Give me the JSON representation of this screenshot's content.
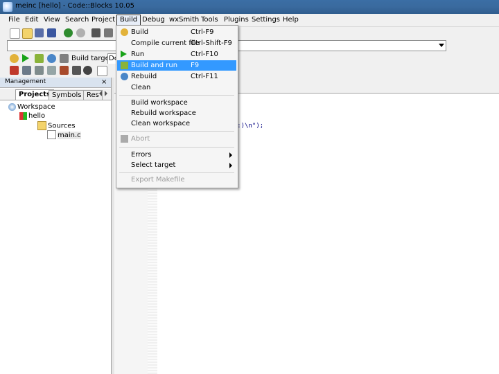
{
  "window": {
    "title": "meinc [hello] - Code::Blocks 10.05"
  },
  "menubar": {
    "items": [
      "File",
      "Edit",
      "View",
      "Search",
      "Project",
      "Build",
      "Debug",
      "wxSmith",
      "Tools",
      "Plugins",
      "Settings",
      "Help"
    ],
    "active": "Build"
  },
  "toolbar": {
    "build_target_label": "Build target:",
    "build_target_value": "De"
  },
  "build_menu": {
    "items": [
      {
        "label": "Build",
        "shortcut": "Ctrl-F9",
        "icon": "build-gear-icon"
      },
      {
        "label": "Compile current file",
        "shortcut": "Ctrl-Shift-F9",
        "icon": ""
      },
      {
        "label": "Run",
        "shortcut": "Ctrl-F10",
        "icon": "run-play-icon"
      },
      {
        "label": "Build and run",
        "shortcut": "F9",
        "icon": "build-and-run-icon",
        "highlighted": true
      },
      {
        "label": "Rebuild",
        "shortcut": "Ctrl-F11",
        "icon": "rebuild-icon"
      },
      {
        "label": "Clean",
        "shortcut": "",
        "icon": ""
      },
      {
        "label": "Build workspace",
        "shortcut": "",
        "icon": ""
      },
      {
        "label": "Rebuild workspace",
        "shortcut": "",
        "icon": ""
      },
      {
        "label": "Clean workspace",
        "shortcut": "",
        "icon": ""
      },
      {
        "label": "Abort",
        "shortcut": "",
        "icon": "abort-icon",
        "disabled": true
      },
      {
        "label": "Errors",
        "shortcut": "",
        "submenu": true
      },
      {
        "label": "Select target",
        "shortcut": "",
        "submenu": true
      },
      {
        "label": "Export Makefile",
        "shortcut": "",
        "disabled": true
      }
    ]
  },
  "management": {
    "header": "Management",
    "close": "×",
    "tabs": [
      "Projects",
      "Symbols",
      "Res"
    ],
    "tree": {
      "workspace": "Workspace",
      "project": "hello",
      "folder": "Sources",
      "file": "main.c"
    }
  },
  "editor": {
    "code_fragment": "ld :)\\n\");"
  },
  "colors": {
    "highlight": "#3399ff",
    "titlebar": "#3a6a9e"
  }
}
